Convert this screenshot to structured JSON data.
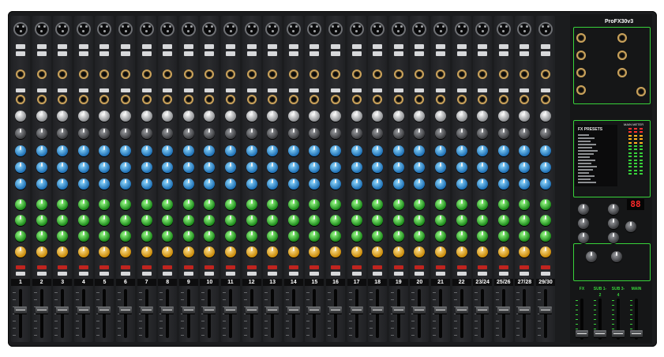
{
  "brand": {
    "name": "ProFX30v3"
  },
  "channels": [
    {
      "label": "1",
      "color": "#ffffff"
    },
    {
      "label": "2",
      "color": "#ffffff"
    },
    {
      "label": "3",
      "color": "#ffffff"
    },
    {
      "label": "4",
      "color": "#ffffff"
    },
    {
      "label": "5",
      "color": "#ffffff"
    },
    {
      "label": "6",
      "color": "#ffffff"
    },
    {
      "label": "7",
      "color": "#ffffff"
    },
    {
      "label": "8",
      "color": "#ffffff"
    },
    {
      "label": "9",
      "color": "#ffffff"
    },
    {
      "label": "10",
      "color": "#ffffff"
    },
    {
      "label": "11",
      "color": "#ffffff"
    },
    {
      "label": "12",
      "color": "#ffffff"
    },
    {
      "label": "13",
      "color": "#ffffff"
    },
    {
      "label": "14",
      "color": "#ffffff"
    },
    {
      "label": "15",
      "color": "#ffffff"
    },
    {
      "label": "16",
      "color": "#ffffff"
    },
    {
      "label": "17",
      "color": "#ffffff"
    },
    {
      "label": "18",
      "color": "#ffffff"
    },
    {
      "label": "19",
      "color": "#ffffff"
    },
    {
      "label": "20",
      "color": "#ffffff"
    },
    {
      "label": "21",
      "color": "#ffffff"
    },
    {
      "label": "22",
      "color": "#ffffff"
    },
    {
      "label": "23/24",
      "color": "#ffffff"
    },
    {
      "label": "25/26",
      "color": "#ffffff"
    },
    {
      "label": "27/28",
      "color": "#ffffff"
    },
    {
      "label": "29/30",
      "color": "#ffffff"
    }
  ],
  "master": {
    "fx_presets_label": "FX PRESETS",
    "display_value": "88",
    "fader_labels": [
      "FX",
      "SUB 1-2",
      "SUB 3-4",
      "MAIN"
    ],
    "main_meter_label": "MAIN METER"
  },
  "colors": {
    "accent_green": "#38d23a",
    "eq_blue": "#2a8fd8",
    "aux_green": "#2fb52a",
    "pan_yellow": "#e3a81a",
    "mute_red": "#c0241f"
  }
}
